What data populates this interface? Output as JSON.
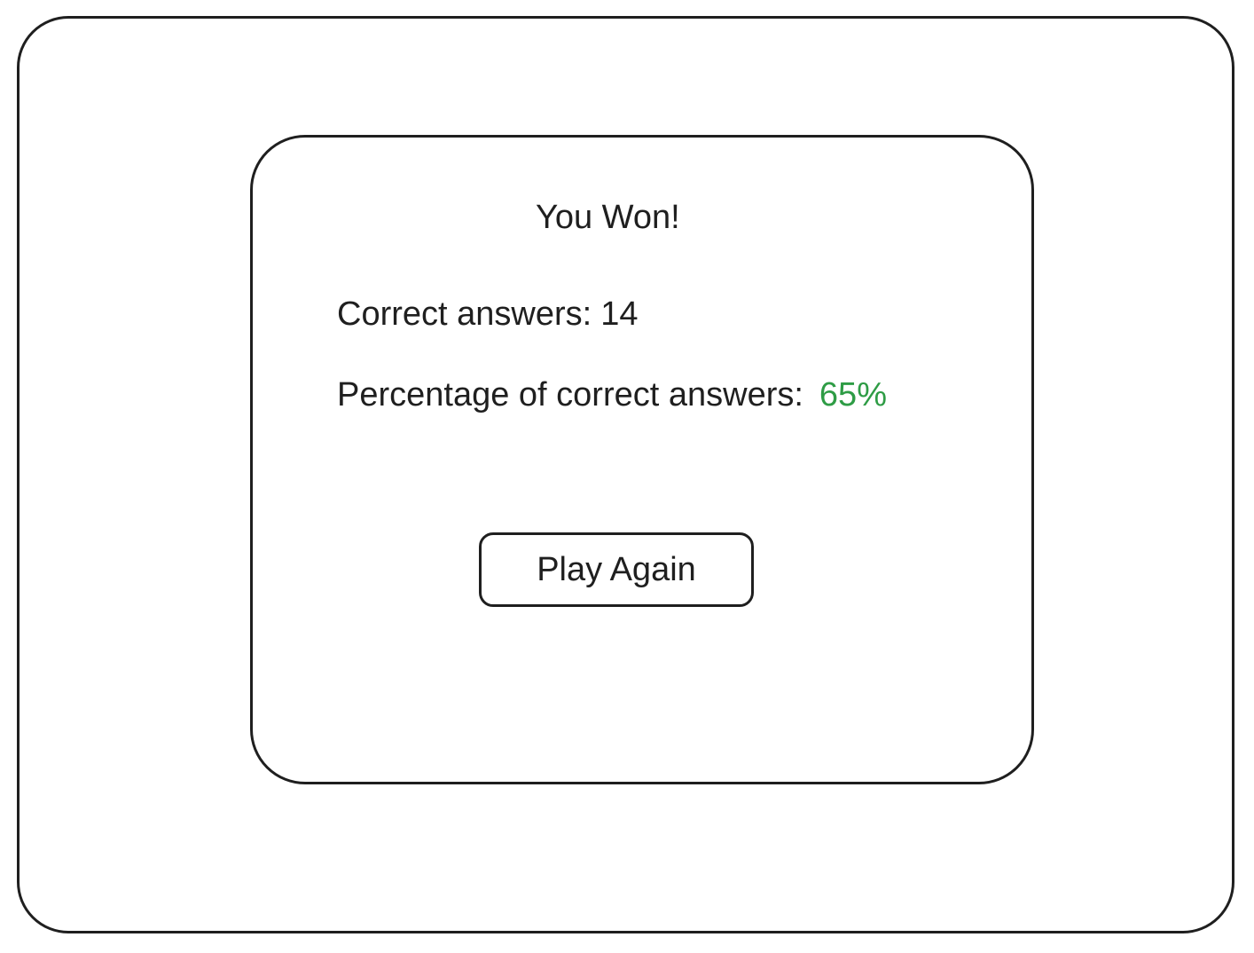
{
  "result": {
    "title": "You Won!",
    "correct_label": "Correct answers:",
    "correct_value": "14",
    "percent_label": "Percentage of correct answers:",
    "percent_value": "65%",
    "percent_color": "#2e9c45",
    "play_again_label": "Play Again"
  }
}
